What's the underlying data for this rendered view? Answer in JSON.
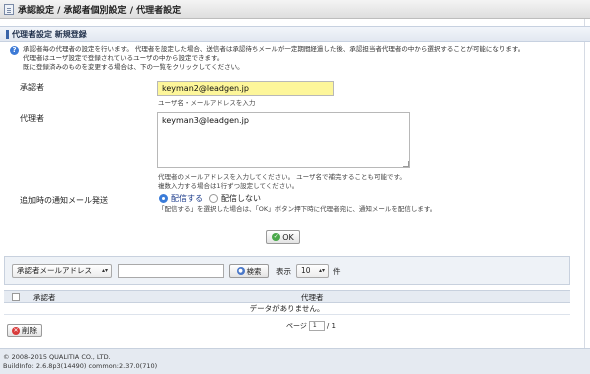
{
  "titlebar": {
    "title": "承認設定 / 承認者個別設定 / 代理者設定"
  },
  "section": {
    "title": "代理者設定 新規登録"
  },
  "help": {
    "lines": [
      "承認者毎の代理者の設定を行います。 代理者を設定した場合、送信者は承認待ちメールが一定期間経過した後、承認担当者代理者の中から選択することが可能になります。",
      "代理者はユーザ設定で登録されているユーザの中から設定できます。",
      "既に登録済みのものを変更する場合は、下の一覧をクリックしてください。"
    ]
  },
  "form": {
    "approver_label": "承認者",
    "approver_value": "keyman2@leadgen.jp",
    "approver_hint": "ユーザ名・メールアドレスを入力",
    "proxy_label": "代理者",
    "proxy_value": "keyman3@leadgen.jp",
    "proxy_hint_1": "代理者のメールアドレスを入力してください。 ユーザ名で補完することも可能です。",
    "proxy_hint_2": "複数入力する場合は1行ずつ設定してください。",
    "notify_label": "追加時の通知メール発送",
    "notify_on": "配信する",
    "notify_off": "配信しない",
    "notify_hint": "「配信する」を選択した場合は、「OK」ボタン押下時に代理者宛に、通知メールを配信します。",
    "ok_label": "OK"
  },
  "search": {
    "field_select": "承認者メールアドレス",
    "search_label": "検索",
    "display_label": "表示",
    "count_value": "10",
    "count_unit": "件"
  },
  "table": {
    "col_approver": "承認者",
    "col_proxy": "代理者",
    "empty": "データがありません。"
  },
  "pager": {
    "page_label": "ページ",
    "page_value": "1",
    "total": "/ 1"
  },
  "delete_label": "削除",
  "footer": {
    "copyright": "© 2008-2015 QUALITIA CO., LTD.",
    "build": "BuildInfo: 2.6.8p3(14490) common:2.37.0(710)"
  }
}
